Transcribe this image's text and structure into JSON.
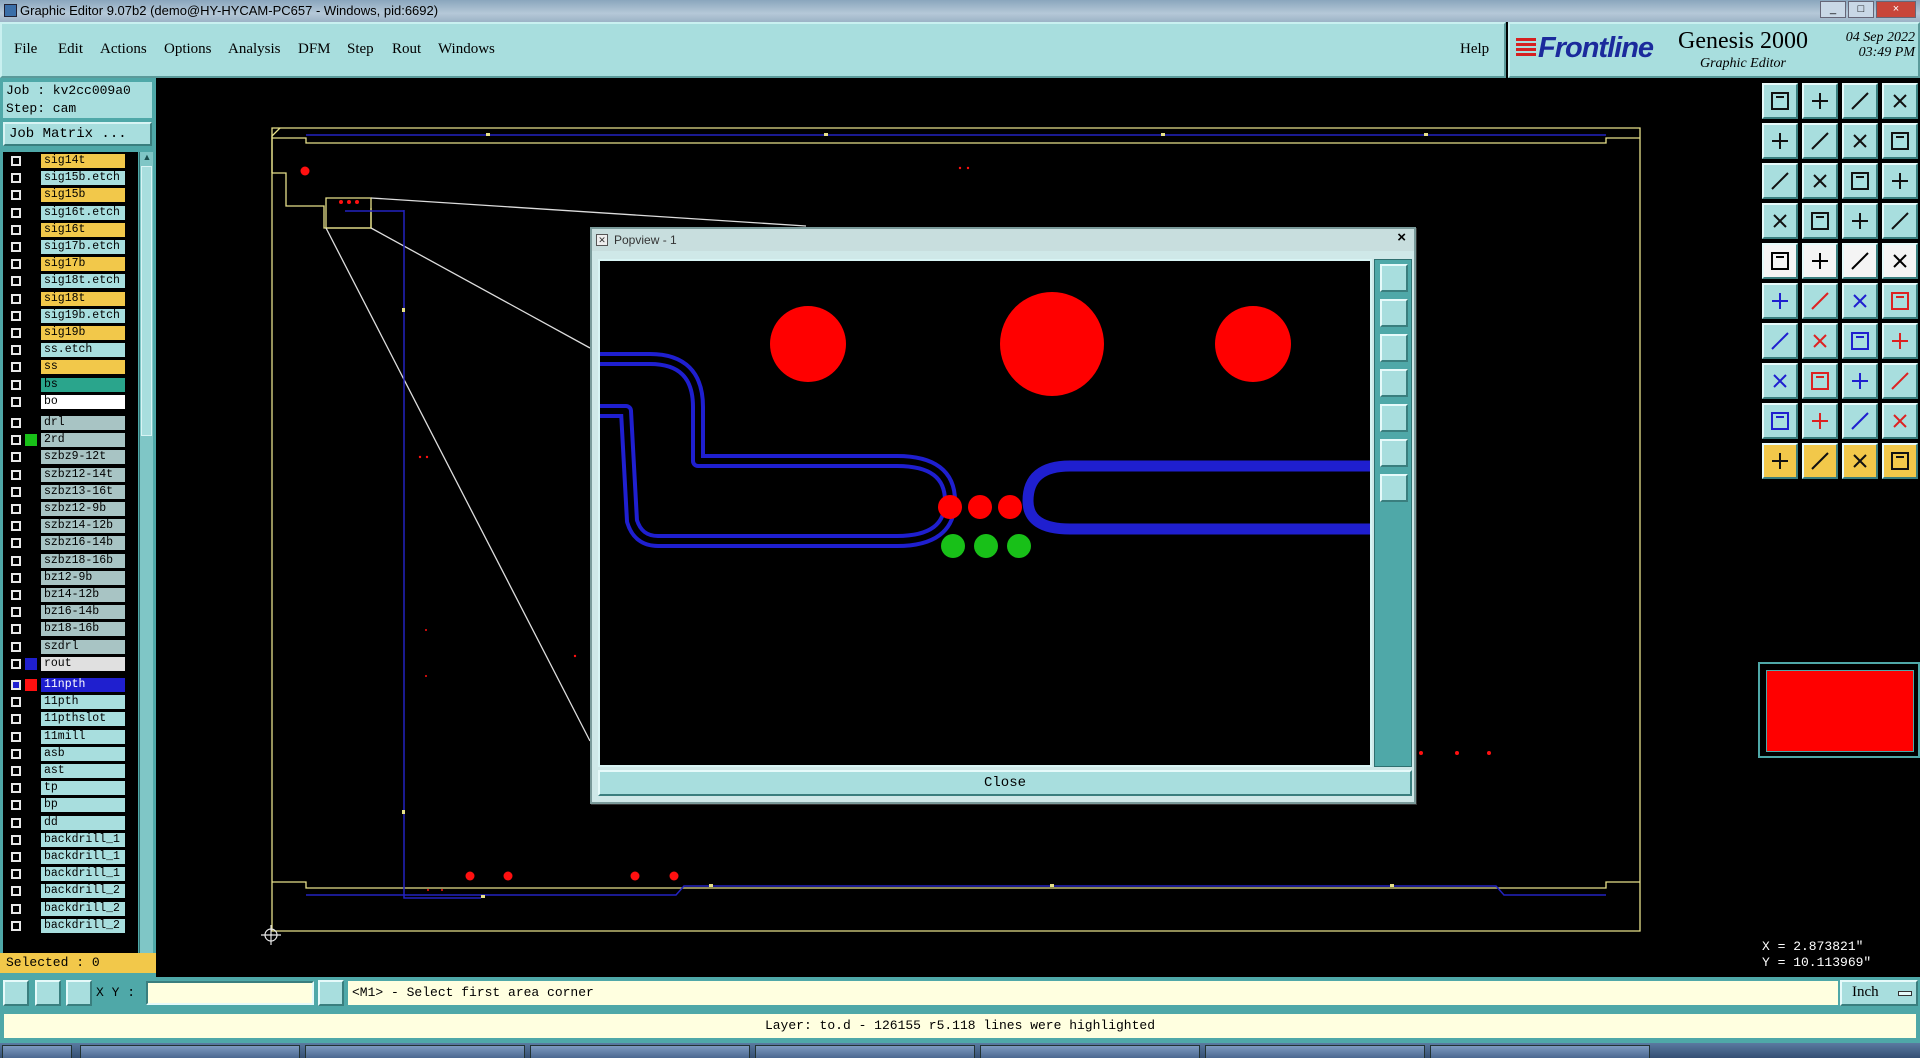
{
  "window": {
    "title": "Graphic Editor 9.07b2 (demo@HY-HYCAM-PC657 - Windows, pid:6692)",
    "controls": [
      "_",
      "□",
      "×"
    ]
  },
  "menu": {
    "items": [
      "File",
      "Edit",
      "Actions",
      "Options",
      "Analysis",
      "DFM",
      "Step",
      "Rout",
      "Windows"
    ],
    "help": "Help"
  },
  "brand": {
    "logo": "Frontline",
    "product": "Genesis 2000",
    "subtitle": "Graphic Editor",
    "date": "04 Sep 2022",
    "time": "03:49 PM"
  },
  "job": {
    "job_line": "Job : kv2cc009a0",
    "step_line": "Step: cam",
    "matrix_button": "Job Matrix ...",
    "selected": "Selected : 0"
  },
  "layers": [
    {
      "name": "sig14t",
      "color": "#f2c84a"
    },
    {
      "name": "sig15b.etch",
      "color": "#a8dede"
    },
    {
      "name": "sig15b",
      "color": "#f2c84a"
    },
    {
      "name": "sig16t.etch",
      "color": "#a8dede"
    },
    {
      "name": "sig16t",
      "color": "#f2c84a"
    },
    {
      "name": "sig17b.etch",
      "color": "#a8dede"
    },
    {
      "name": "sig17b",
      "color": "#f2c84a"
    },
    {
      "name": "sig18t.etch",
      "color": "#a8dede"
    },
    {
      "name": "sig18t",
      "color": "#f2c84a"
    },
    {
      "name": "sig19b.etch",
      "color": "#a8dede"
    },
    {
      "name": "sig19b",
      "color": "#f2c84a"
    },
    {
      "name": "ss.etch",
      "color": "#a8dede"
    },
    {
      "name": "ss",
      "color": "#f2c84a"
    },
    {
      "name": "bs",
      "color": "#2aa58c"
    },
    {
      "name": "bo",
      "color": "#ffffff"
    },
    {
      "name": "drl",
      "color": "#a8c4c4"
    },
    {
      "name": "2rd",
      "color": "#a8c4c4",
      "work": "#18c018"
    },
    {
      "name": "szbz9-12t",
      "color": "#a8c4c4"
    },
    {
      "name": "szbz12-14t",
      "color": "#a8c4c4"
    },
    {
      "name": "szbz13-16t",
      "color": "#a8c4c4"
    },
    {
      "name": "szbz12-9b",
      "color": "#a8c4c4"
    },
    {
      "name": "szbz14-12b",
      "color": "#a8c4c4"
    },
    {
      "name": "szbz16-14b",
      "color": "#a8c4c4"
    },
    {
      "name": "szbz18-16b",
      "color": "#a8c4c4"
    },
    {
      "name": "bz12-9b",
      "color": "#a8c4c4"
    },
    {
      "name": "bz14-12b",
      "color": "#a8c4c4"
    },
    {
      "name": "bz16-14b",
      "color": "#a8c4c4"
    },
    {
      "name": "bz18-16b",
      "color": "#a8c4c4"
    },
    {
      "name": "szdrl",
      "color": "#a8c4c4"
    },
    {
      "name": "rout",
      "color": "#e0e0e0",
      "work": "#1f1fcf"
    },
    {
      "name": "11npth",
      "color": "#1f1fcf",
      "work": "#ff1010",
      "active": true
    },
    {
      "name": "11pth",
      "color": "#a8dede"
    },
    {
      "name": "11pthslot",
      "color": "#a8dede"
    },
    {
      "name": "11mill",
      "color": "#a8dede"
    },
    {
      "name": "asb",
      "color": "#a8dede"
    },
    {
      "name": "ast",
      "color": "#a8dede"
    },
    {
      "name": "tp",
      "color": "#a8dede"
    },
    {
      "name": "bp",
      "color": "#a8dede"
    },
    {
      "name": "dd",
      "color": "#a8dede"
    },
    {
      "name": "backdrill_1",
      "color": "#a8dede"
    },
    {
      "name": "backdrill_1",
      "color": "#a8dede"
    },
    {
      "name": "backdrill_1",
      "color": "#a8dede"
    },
    {
      "name": "backdrill_2",
      "color": "#a8dede"
    },
    {
      "name": "backdrill_2",
      "color": "#a8dede"
    },
    {
      "name": "backdrill_2",
      "color": "#a8dede"
    }
  ],
  "popview": {
    "title": "Popview - 1",
    "close_x": "×",
    "close_button": "Close"
  },
  "status": {
    "xy_label": "X Y :",
    "xy_value": "",
    "prompt": "<M1> - Select first area corner",
    "units": "Inch",
    "message": "Layer: to.d - 126155 r5.118 lines were highlighted"
  },
  "coords": {
    "x": "X = 2.873821\"",
    "y": "Y = 10.113969\""
  },
  "colors": {
    "panel": "#a8dede",
    "panel_dark": "#4fa8a8",
    "highlight_layer": "#f2c84a",
    "pad_red": "#ff0000",
    "pad_green": "#18c018",
    "trace_blue": "#1f1fcf",
    "outline_yellow": "#e6e08a"
  }
}
